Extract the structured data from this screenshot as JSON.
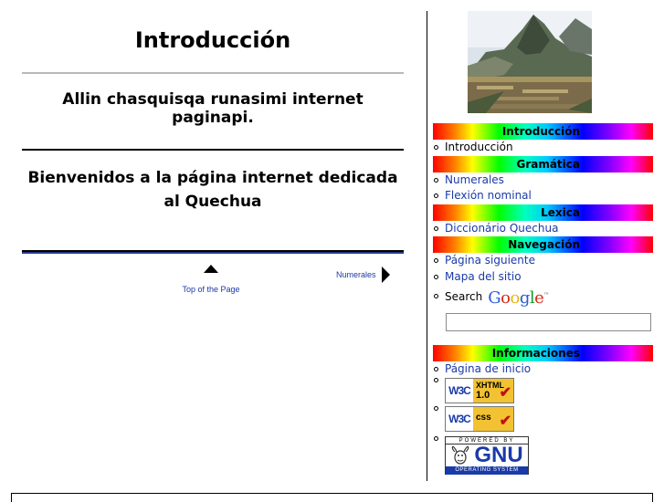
{
  "main": {
    "title": "Introducción",
    "lead": "Allin chasquisqa runasimi internet paginapi.",
    "welcome": "Bienvenidos a la página internet dedicada al Quechua",
    "top_link": "Top of the Page",
    "next_link": "Numerales"
  },
  "sidebar": {
    "sections": [
      {
        "header": "Introducción",
        "items": [
          {
            "label": "Introducción"
          }
        ]
      },
      {
        "header": "Gramática",
        "items": [
          {
            "label": "Numerales"
          },
          {
            "label": "Flexión nominal"
          }
        ]
      },
      {
        "header": "Lexica",
        "items": [
          {
            "label": "Diccionário Quechua"
          }
        ]
      },
      {
        "header": "Navegación",
        "items": [
          {
            "label": "Página siguiente"
          },
          {
            "label": "Mapa del sitio"
          }
        ]
      },
      {
        "header": "Informaciones",
        "items": [
          {
            "label": "Página de inicio"
          }
        ]
      }
    ],
    "search_label": "Search",
    "search_logo": "Google",
    "search_value": ""
  },
  "badges": {
    "xhtml": {
      "left": "W3C",
      "line1": "XHTML",
      "line2": "1.0"
    },
    "css": {
      "left": "W3C",
      "line1": "css"
    },
    "gnu": {
      "top": "POWERED BY",
      "word": "GNU",
      "bottom": "OPERATING SYSTEM"
    }
  },
  "icons": [
    "triangle-up-icon",
    "triangle-right-icon",
    "check-icon",
    "gnu-head-icon"
  ]
}
